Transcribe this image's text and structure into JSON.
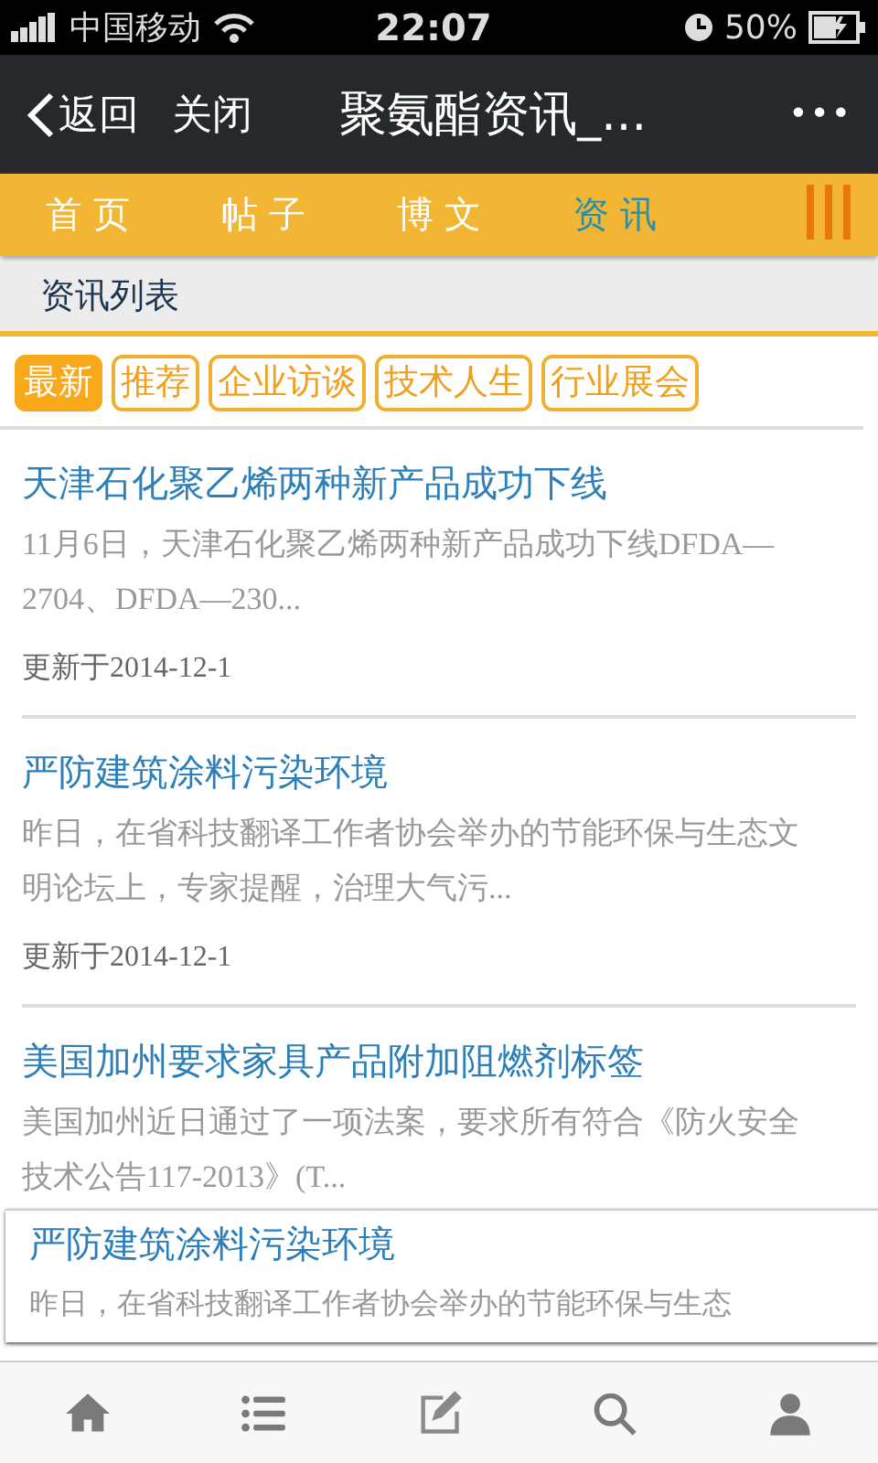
{
  "status_bar": {
    "carrier": "中国移动",
    "time": "22:07",
    "battery": "50%"
  },
  "nav_bar": {
    "back": "返回",
    "close": "关闭",
    "title": "聚氨酯资讯_...",
    "more": "•••"
  },
  "tabs": [
    {
      "label": "首 页",
      "selected": false
    },
    {
      "label": "帖 子",
      "selected": false
    },
    {
      "label": "博 文",
      "selected": false
    },
    {
      "label": "资 讯",
      "selected": true
    }
  ],
  "section_title": "资讯列表",
  "filters": [
    {
      "label": "最新",
      "selected": true
    },
    {
      "label": "推荐",
      "selected": false
    },
    {
      "label": "企业访谈",
      "selected": false
    },
    {
      "label": "技术人生",
      "selected": false
    },
    {
      "label": "行业展会",
      "selected": false
    }
  ],
  "articles": [
    {
      "title": "天津石化聚乙烯两种新产品成功下线",
      "summary": "11月6日，天津石化聚乙烯两种新产品成功下线DFDA—2704、DFDA—230...",
      "date": "更新于2014-12-1"
    },
    {
      "title": "严防建筑涂料污染环境",
      "summary": "昨日，在省科技翻译工作者协会举办的节能环保与生态文明论坛上，专家提醒，治理大气污...",
      "date": "更新于2014-12-1"
    },
    {
      "title": "美国加州要求家具产品附加阻燃剂标签",
      "summary": "美国加州近日通过了一项法案，要求所有符合《防火安全技术公告117-2013》(T..."
    }
  ],
  "overlay_card": {
    "title": "严防建筑涂料污染环境",
    "summary": "昨日，在省科技翻译工作者协会举办的节能环保与生态"
  },
  "bottom_tabs": [
    {
      "kind": "home"
    },
    {
      "kind": "list"
    },
    {
      "kind": "compose"
    },
    {
      "kind": "search"
    },
    {
      "kind": "user"
    }
  ]
}
